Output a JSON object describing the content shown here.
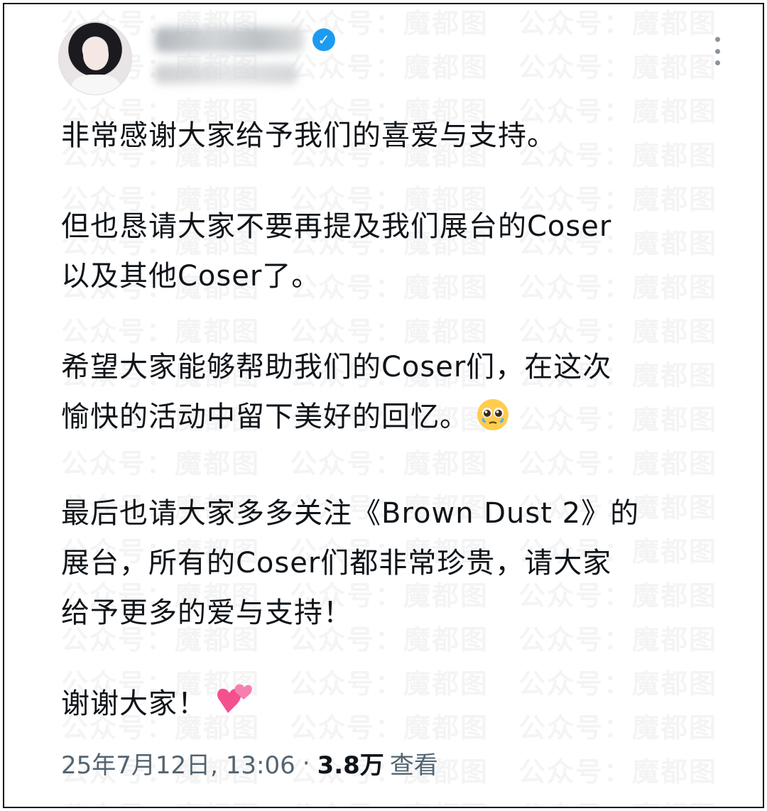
{
  "watermark": {
    "text": "公众号：魔都图"
  },
  "header": {
    "verified_icon": "verified-badge-icon",
    "verified_color": "#1d9bf0",
    "more_icon": "more-vertical-icon"
  },
  "tweet": {
    "paragraphs": [
      [
        "非常感谢大家给予我们的喜爱与支持。"
      ],
      [
        "但也恳请大家不要再提及我们展台的Coser",
        "以及其他Coser了。"
      ],
      [
        "希望大家能够帮助我们的Coser们，在这次",
        "愉快的活动中留下美好的回忆。"
      ],
      [
        "最后也请大家多多关注《Brown Dust 2》的",
        "展台，所有的Coser们都非常珍贵，请大家",
        "给予更多的爱与支持！"
      ],
      [
        "谢谢大家！"
      ]
    ],
    "emoji_1": "pleading-face-emoji",
    "emoji_2": "two-hearts-emoji"
  },
  "meta": {
    "datetime": "25年7月12日, 13:06",
    "separator": "·",
    "views_count": "3.8万",
    "views_label": "查看"
  }
}
